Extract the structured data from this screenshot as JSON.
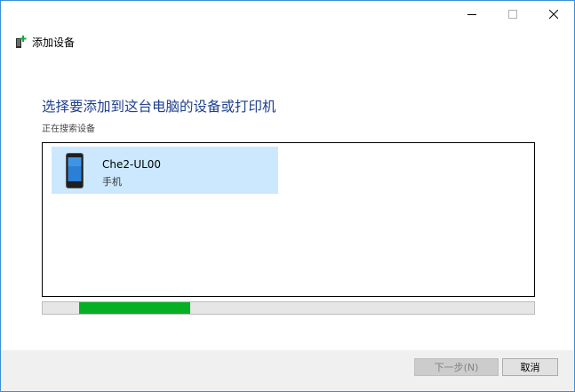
{
  "window": {
    "title": "添加设备",
    "controls": {
      "minimize": "minimize-icon",
      "maximize": "maximize-icon",
      "close": "close-icon"
    }
  },
  "main": {
    "heading": "选择要添加到这台电脑的设备或打印机",
    "status": "正在搜索设备"
  },
  "devices": [
    {
      "name": "Che2-UL00",
      "type": "手机",
      "icon": "phone-icon",
      "selected": true
    }
  ],
  "progress": {
    "state": "searching",
    "fill_start": 0.075,
    "fill_end": 0.3
  },
  "footer": {
    "next_label": "下一步(N)",
    "cancel_label": "取消"
  },
  "colors": {
    "heading": "#1e3f8c",
    "selection": "#cce8ff",
    "progress_fill": "#06b025",
    "border_accent": "#3b8fd6"
  }
}
